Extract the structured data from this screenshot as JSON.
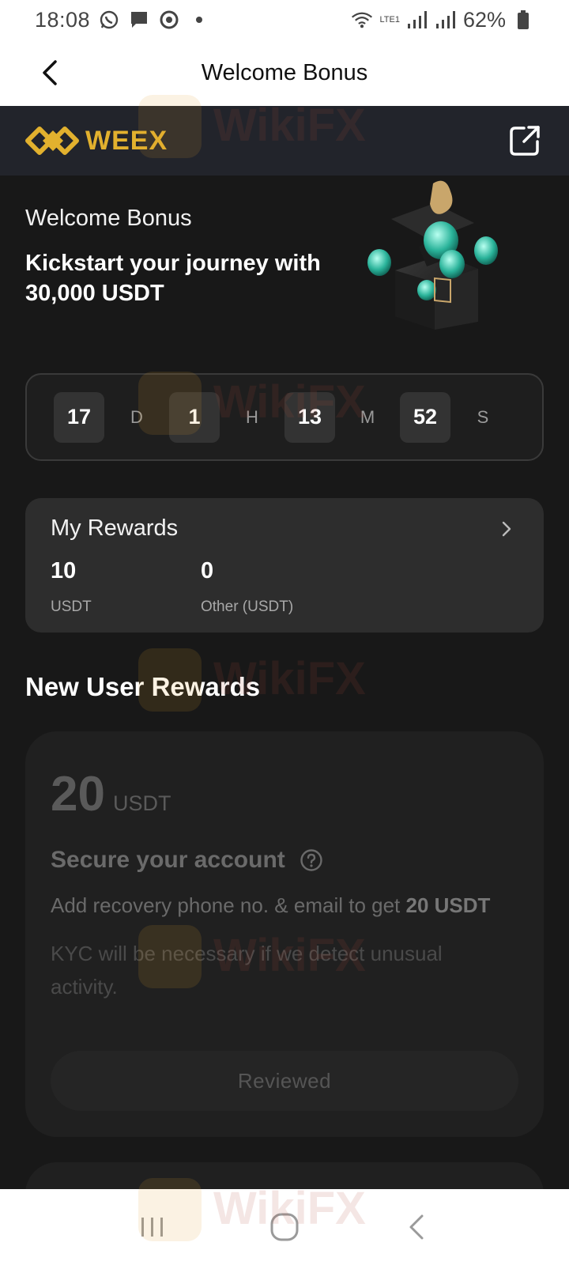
{
  "status_bar": {
    "time": "18:08",
    "battery": "62%",
    "network_label": "LTE1"
  },
  "header": {
    "title": "Welcome Bonus"
  },
  "brand": {
    "name": "WEEX",
    "color": "#e2b12e"
  },
  "hero": {
    "title": "Welcome Bonus",
    "subtitle": "Kickstart your journey with 30,000 USDT"
  },
  "countdown": {
    "days": "17",
    "days_unit": "D",
    "hours": "1",
    "hours_unit": "H",
    "minutes": "13",
    "minutes_unit": "M",
    "seconds": "52",
    "seconds_unit": "S"
  },
  "my_rewards": {
    "title": "My Rewards",
    "items": [
      {
        "value": "10",
        "label": "USDT"
      },
      {
        "value": "0",
        "label": "Other (USDT)"
      }
    ]
  },
  "new_user_rewards": {
    "title": "New User Rewards",
    "task": {
      "amount": "20",
      "unit": "USDT",
      "title": "Secure your account",
      "description": "Add recovery phone no. & email to get ",
      "description_bold": "20 USDT",
      "note": "KYC will be necessary if we detect unusual activity.",
      "button": "Reviewed"
    }
  },
  "watermark": {
    "text": "WikiFX"
  }
}
